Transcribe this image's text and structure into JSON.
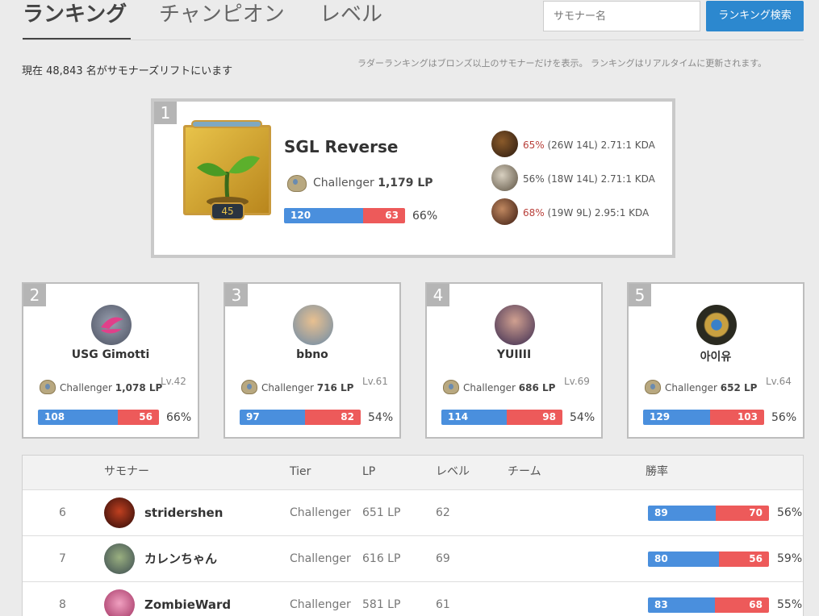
{
  "nav": {
    "tabs": [
      "ランキング",
      "チャンピオン",
      "レベル"
    ],
    "search_placeholder": "サモナー名",
    "search_button": "ランキング検索"
  },
  "info": {
    "total": "現在 48,843 名がサモナーズリフトにいます",
    "note": "ラダーランキングはブロンズ以上のサモナーだけを表示。 ランキングはリアルタイムに更新されます。"
  },
  "top1": {
    "rank": "1",
    "name": "SGL Reverse",
    "level": "45",
    "tier": "Challenger",
    "lp": "1,179 LP",
    "wins": "120",
    "losses": "63",
    "winrate_pct": "66%",
    "wins_fraction": 0.656,
    "champions": [
      {
        "wr": "65%",
        "record": " (26W 14L) 2.71:1 KDA",
        "highlight": true
      },
      {
        "wr": "56%",
        "record": " (18W 14L) 2.71:1 KDA",
        "highlight": false
      },
      {
        "wr": "68%",
        "record": " (19W 9L) 2.95:1 KDA",
        "highlight": true
      }
    ]
  },
  "top_cards": [
    {
      "rank": "2",
      "name": "USG Gimotti",
      "tier": "Challenger",
      "lp": "1,078 LP",
      "level": "Lv.42",
      "wins": "108",
      "losses": "56",
      "winrate_pct": "66%",
      "wins_fraction": 0.659
    },
    {
      "rank": "3",
      "name": "bbno",
      "tier": "Challenger",
      "lp": "716 LP",
      "level": "Lv.61",
      "wins": "97",
      "losses": "82",
      "winrate_pct": "54%",
      "wins_fraction": 0.542
    },
    {
      "rank": "4",
      "name": "YUIIII",
      "tier": "Challenger",
      "lp": "686 LP",
      "level": "Lv.69",
      "wins": "114",
      "losses": "98",
      "winrate_pct": "54%",
      "wins_fraction": 0.538
    },
    {
      "rank": "5",
      "name": "아이유",
      "tier": "Challenger",
      "lp": "652 LP",
      "level": "Lv.64",
      "wins": "129",
      "losses": "103",
      "winrate_pct": "56%",
      "wins_fraction": 0.556
    }
  ],
  "table": {
    "headers": {
      "summoner": "サモナー",
      "tier": "Tier",
      "lp": "LP",
      "level": "レベル",
      "team": "チーム",
      "winrate": "勝率"
    },
    "rows": [
      {
        "rank": "6",
        "name": "stridershen",
        "tier": "Challenger",
        "lp": "651 LP",
        "level": "62",
        "wins": "89",
        "losses": "70",
        "winrate_pct": "56%",
        "wins_fraction": 0.56
      },
      {
        "rank": "7",
        "name": "カレンちゃん",
        "tier": "Challenger",
        "lp": "616 LP",
        "level": "69",
        "wins": "80",
        "losses": "56",
        "winrate_pct": "59%",
        "wins_fraction": 0.588
      },
      {
        "rank": "8",
        "name": "ZombieWard",
        "tier": "Challenger",
        "lp": "581 LP",
        "level": "61",
        "wins": "83",
        "losses": "68",
        "winrate_pct": "55%",
        "wins_fraction": 0.55
      }
    ]
  }
}
